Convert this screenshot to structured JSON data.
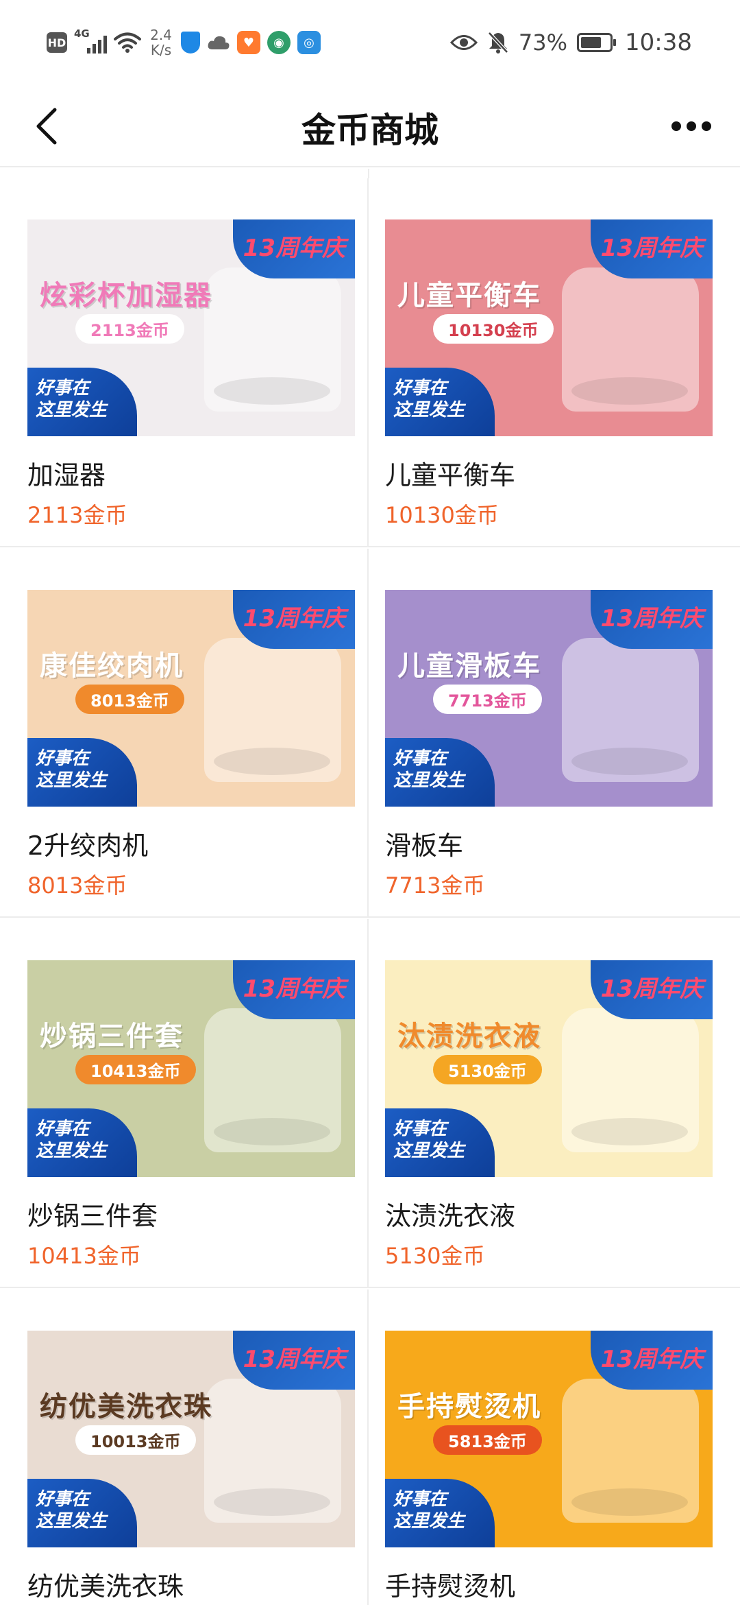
{
  "status_bar": {
    "hd": "HD",
    "network": "4G",
    "speed": "2.4\nK/s",
    "battery_percent": "73%",
    "battery_level": 0.73,
    "time": "10:38"
  },
  "header": {
    "title": "金币商城"
  },
  "products": [
    {
      "name": "加湿器",
      "price": "2113金币",
      "banner": {
        "title": "炫彩杯加湿器",
        "pill": "2113金币",
        "bg": "#f1edef",
        "title_color": "#f07ab8",
        "pill_bg": "#ffffff",
        "pill_color": "#f07ab8"
      },
      "anniversary": "13周年庆",
      "promo": "好事在\n这里发生"
    },
    {
      "name": "儿童平衡车",
      "price": "10130金币",
      "banner": {
        "title": "儿童平衡车",
        "pill": "10130金币",
        "bg": "#e88c92",
        "title_color": "#ffffff",
        "pill_bg": "#ffffff",
        "pill_color": "#d4404f"
      },
      "anniversary": "13周年庆",
      "promo": "好事在\n这里发生"
    },
    {
      "name": "2升绞肉机",
      "price": "8013金币",
      "banner": {
        "title": "康佳绞肉机",
        "pill": "8013金币",
        "bg": "#f6d6b4",
        "title_color": "#ffffff",
        "pill_bg": "#f08a2c",
        "pill_color": "#ffffff"
      },
      "anniversary": "13周年庆",
      "promo": "好事在\n这里发生"
    },
    {
      "name": "滑板车",
      "price": "7713金币",
      "banner": {
        "title": "儿童滑板车",
        "pill": "7713金币",
        "bg": "#a58fcc",
        "title_color": "#ffffff",
        "pill_bg": "#ffffff",
        "pill_color": "#e3569b"
      },
      "anniversary": "13周年庆",
      "promo": "好事在\n这里发生"
    },
    {
      "name": "炒锅三件套",
      "price": "10413金币",
      "banner": {
        "title": "炒锅三件套",
        "pill": "10413金币",
        "bg": "#c9cfa4",
        "title_color": "#ffffff",
        "pill_bg": "#f08a2c",
        "pill_color": "#ffffff"
      },
      "anniversary": "13周年庆",
      "promo": "好事在\n这里发生"
    },
    {
      "name": "汰渍洗衣液",
      "price": "5130金币",
      "banner": {
        "title": "汰渍洗衣液",
        "pill": "5130金币",
        "bg": "#fbeec0",
        "title_color": "#f08a2c",
        "pill_bg": "#f5a623",
        "pill_color": "#ffffff"
      },
      "anniversary": "13周年庆",
      "promo": "好事在\n这里发生"
    },
    {
      "name": "纺优美洗衣珠",
      "price": "10013金币",
      "banner": {
        "title": "纺优美洗衣珠",
        "pill": "10013金币",
        "bg": "#e9dcd2",
        "title_color": "#5b3a22",
        "pill_bg": "#ffffff",
        "pill_color": "#5b3a22"
      },
      "anniversary": "13周年庆",
      "promo": "好事在\n这里发生"
    },
    {
      "name": "手持熨烫机",
      "price": "5813金币",
      "banner": {
        "title": "手持熨烫机",
        "pill": "5813金币",
        "bg": "#f7a91b",
        "title_color": "#ffffff",
        "pill_bg": "#e8531f",
        "pill_color": "#ffffff"
      },
      "anniversary": "13周年庆",
      "promo": "好事在\n这里发生"
    }
  ]
}
